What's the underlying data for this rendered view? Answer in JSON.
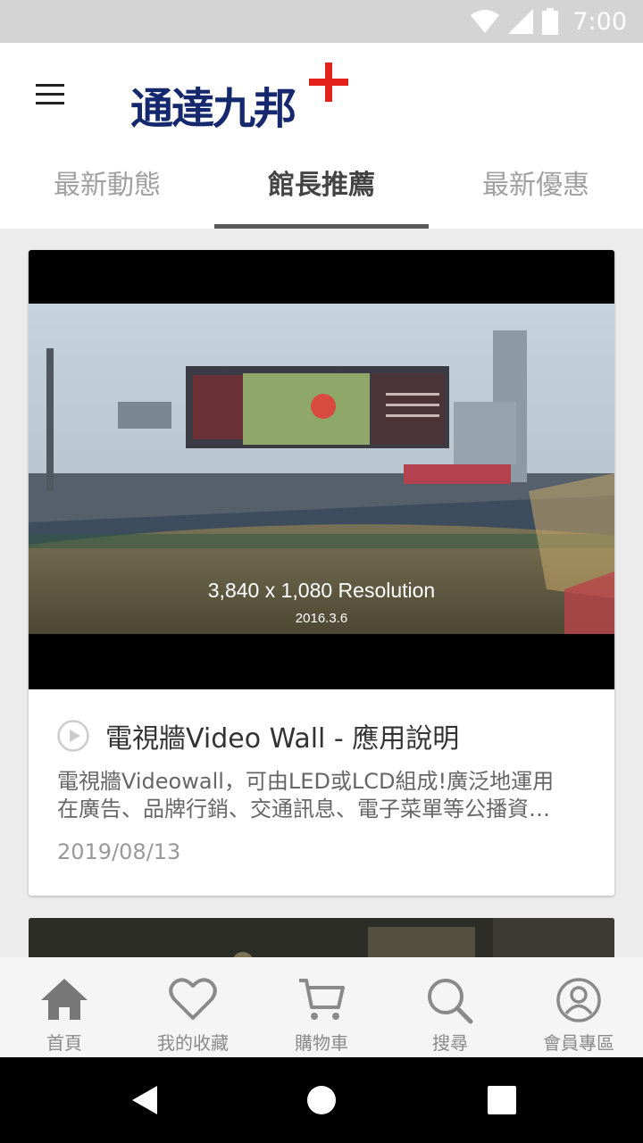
{
  "status_bar": {
    "time": "7:00",
    "icons": [
      "wifi-icon",
      "signal-icon",
      "battery-icon"
    ]
  },
  "header": {
    "logo_text": "通達九邦",
    "logo_colors": {
      "text": "#15286e",
      "plus": "#e3231b"
    }
  },
  "tabs": [
    {
      "label": "最新動態",
      "active": false
    },
    {
      "label": "館長推薦",
      "active": true
    },
    {
      "label": "最新優惠",
      "active": false
    }
  ],
  "card": {
    "thumbnail_caption": "3,840 x 1,080 Resolution",
    "thumbnail_date": "2016.3.6",
    "title": "電視牆Video Wall - 應用說明",
    "description_line1": "電視牆Videowall，可由LED或LCD組成!廣泛地運用",
    "description_line2": "在廣告、品牌行銷、交通訊息、電子菜單等公播資…",
    "date": "2019/08/13"
  },
  "bottom_nav": [
    {
      "label": "首頁",
      "icon": "home-icon",
      "active": true
    },
    {
      "label": "我的收藏",
      "icon": "heart-icon",
      "active": false
    },
    {
      "label": "購物車",
      "icon": "cart-icon",
      "active": false
    },
    {
      "label": "搜尋",
      "icon": "search-icon",
      "active": false
    },
    {
      "label": "會員專區",
      "icon": "user-icon",
      "active": false
    }
  ],
  "colors": {
    "status_bar": "#d4d4d4",
    "tab_indicator": "#5a5a5a",
    "nav_icon": "#8a8a8a",
    "nav_icon_active": "#777777"
  }
}
